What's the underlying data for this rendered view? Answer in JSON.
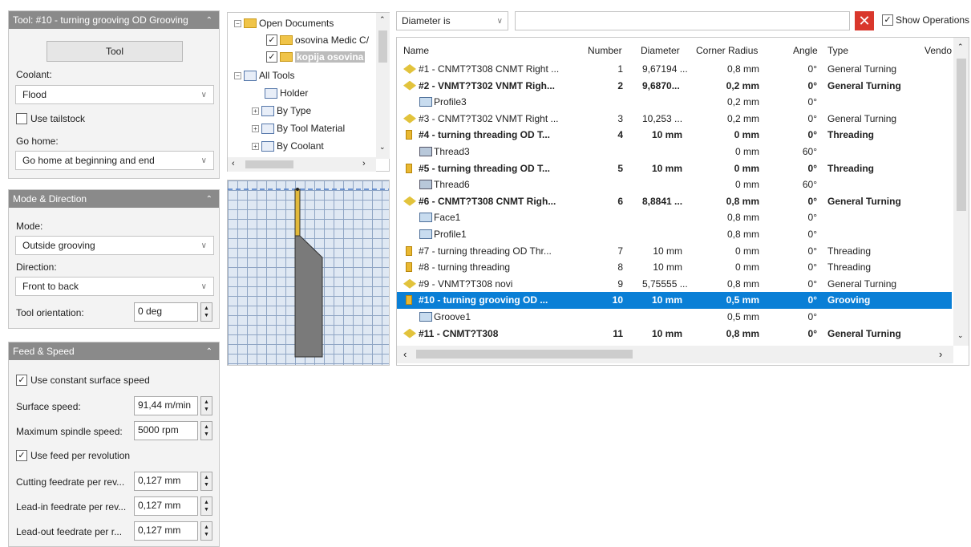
{
  "tool_panel": {
    "title": "Tool: #10 - turning grooving OD Grooving",
    "tool_button": "Tool",
    "coolant_label": "Coolant:",
    "coolant_value": "Flood",
    "tailstock_label": "Use tailstock",
    "gohome_label": "Go home:",
    "gohome_value": "Go home at beginning and end"
  },
  "mode_panel": {
    "title": "Mode & Direction",
    "mode_label": "Mode:",
    "mode_value": "Outside grooving",
    "direction_label": "Direction:",
    "direction_value": "Front to back",
    "orientation_label": "Tool orientation:",
    "orientation_value": "0 deg"
  },
  "feed_panel": {
    "title": "Feed & Speed",
    "css_label": "Use constant surface speed",
    "surface_label": "Surface speed:",
    "surface_value": "91,44 m/min",
    "maxspindle_label": "Maximum spindle speed:",
    "maxspindle_value": "5000 rpm",
    "feedrev_label": "Use feed per revolution",
    "cutting_label": "Cutting feedrate per rev...",
    "cutting_value": "0,127 mm",
    "leadin_label": "Lead-in feedrate per rev...",
    "leadin_value": "0,127 mm",
    "leadout_label": "Lead-out feedrate per r...",
    "leadout_value": "0,127 mm"
  },
  "tree": {
    "open_docs": "Open Documents",
    "doc1": "osovina Medic C/",
    "doc2": "kopija osovina",
    "all_tools": "All Tools",
    "holder": "Holder",
    "by_type": "By Type",
    "by_material": "By Tool Material",
    "by_coolant": "By Coolant"
  },
  "toolbar": {
    "filter_value": "Diameter is",
    "show_ops": "Show Operations"
  },
  "grid": {
    "headers": {
      "name": "Name",
      "number": "Number",
      "diameter": "Diameter",
      "corner": "Corner Radius",
      "angle": "Angle",
      "type": "Type",
      "vendor": "Vendo"
    },
    "rows": [
      {
        "name": "#1 - CNMT?T308 CNMT Right ...",
        "number": "1",
        "diameter": "9,67194 ...",
        "corner": "0,8 mm",
        "angle": "0°",
        "type": "General Turning"
      },
      {
        "name": "#2 - VNMT?T302 VNMT Righ...",
        "number": "2",
        "diameter": "9,6870...",
        "corner": "0,2 mm",
        "angle": "0°",
        "type": "General Turning"
      },
      {
        "name": "Profile3",
        "number": "",
        "diameter": "",
        "corner": "0,2 mm",
        "angle": "0°",
        "type": ""
      },
      {
        "name": "#3 - CNMT?T302 VNMT Right ...",
        "number": "3",
        "diameter": "10,253 ...",
        "corner": "0,2 mm",
        "angle": "0°",
        "type": "General Turning"
      },
      {
        "name": "#4 - turning threading OD T...",
        "number": "4",
        "diameter": "10 mm",
        "corner": "0 mm",
        "angle": "0°",
        "type": "Threading"
      },
      {
        "name": "Thread3",
        "number": "",
        "diameter": "",
        "corner": "0 mm",
        "angle": "60°",
        "type": ""
      },
      {
        "name": "#5 - turning threading OD T...",
        "number": "5",
        "diameter": "10 mm",
        "corner": "0 mm",
        "angle": "0°",
        "type": "Threading"
      },
      {
        "name": "Thread6",
        "number": "",
        "diameter": "",
        "corner": "0 mm",
        "angle": "60°",
        "type": ""
      },
      {
        "name": "#6 - CNMT?T308 CNMT Righ...",
        "number": "6",
        "diameter": "8,8841 ...",
        "corner": "0,8 mm",
        "angle": "0°",
        "type": "General Turning"
      },
      {
        "name": "Face1",
        "number": "",
        "diameter": "",
        "corner": "0,8 mm",
        "angle": "0°",
        "type": ""
      },
      {
        "name": "Profile1",
        "number": "",
        "diameter": "",
        "corner": "0,8 mm",
        "angle": "0°",
        "type": ""
      },
      {
        "name": "#7 - turning threading OD Thr...",
        "number": "7",
        "diameter": "10 mm",
        "corner": "0 mm",
        "angle": "0°",
        "type": "Threading"
      },
      {
        "name": "#8 - turning threading",
        "number": "8",
        "diameter": "10 mm",
        "corner": "0 mm",
        "angle": "0°",
        "type": "Threading"
      },
      {
        "name": "#9 - VNMT?T308 novi",
        "number": "9",
        "diameter": "5,75555 ...",
        "corner": "0,8 mm",
        "angle": "0°",
        "type": "General Turning"
      },
      {
        "name": "#10 - turning grooving OD ...",
        "number": "10",
        "diameter": "10 mm",
        "corner": "0,5 mm",
        "angle": "0°",
        "type": "Grooving"
      },
      {
        "name": "Groove1",
        "number": "",
        "diameter": "",
        "corner": "0,5 mm",
        "angle": "0°",
        "type": ""
      },
      {
        "name": "#11 - CNMT?T308",
        "number": "11",
        "diameter": "10 mm",
        "corner": "0,8 mm",
        "angle": "0°",
        "type": "General Turning"
      }
    ]
  }
}
